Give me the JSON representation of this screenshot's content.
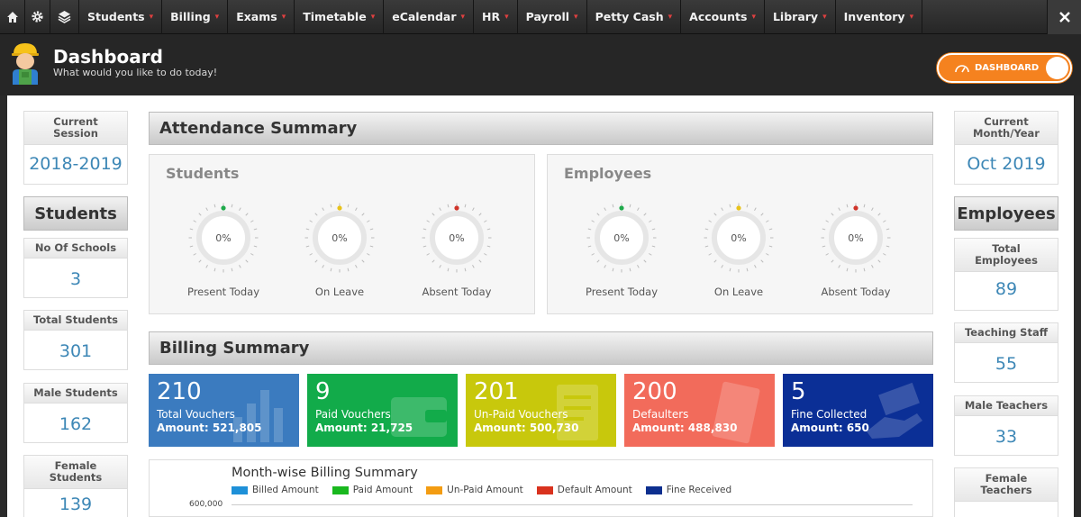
{
  "nav": {
    "items": [
      {
        "label": "Students"
      },
      {
        "label": "Billing"
      },
      {
        "label": "Exams"
      },
      {
        "label": "Timetable"
      },
      {
        "label": "eCalendar"
      },
      {
        "label": "HR"
      },
      {
        "label": "Payroll"
      },
      {
        "label": "Petty Cash"
      },
      {
        "label": "Accounts"
      },
      {
        "label": "Library"
      },
      {
        "label": "Inventory"
      }
    ],
    "icons": [
      "home-icon",
      "gear-icon",
      "layers-icon",
      "close-icon"
    ]
  },
  "header": {
    "title": "Dashboard",
    "subtitle": "What would you like to do today!",
    "toggle_label": "DASHBOARD"
  },
  "left": {
    "session_label": "Current Session",
    "session_value": "2018-2019",
    "section": "Students",
    "stats": [
      {
        "label": "No Of Schools",
        "value": "3"
      },
      {
        "label": "Total Students",
        "value": "301"
      },
      {
        "label": "Male Students",
        "value": "162"
      },
      {
        "label": "Female Students",
        "value": "139"
      }
    ]
  },
  "right": {
    "month_label": "Current Month/Year",
    "month_value": "Oct 2019",
    "section": "Employees",
    "stats": [
      {
        "label": "Total Employees",
        "value": "89"
      },
      {
        "label": "Teaching Staff",
        "value": "55"
      },
      {
        "label": "Male Teachers",
        "value": "33"
      },
      {
        "label": "Female Teachers",
        "value": ""
      }
    ]
  },
  "attendance": {
    "title": "Attendance Summary",
    "students": {
      "title": "Students",
      "gauges": [
        {
          "label": "Present Today",
          "value": "0%",
          "color": "#1faa4b"
        },
        {
          "label": "On Leave",
          "value": "0%",
          "color": "#e8c21a"
        },
        {
          "label": "Absent Today",
          "value": "0%",
          "color": "#d0352a"
        }
      ]
    },
    "employees": {
      "title": "Employees",
      "gauges": [
        {
          "label": "Present Today",
          "value": "0%",
          "color": "#1faa4b"
        },
        {
          "label": "On Leave",
          "value": "0%",
          "color": "#e8c21a"
        },
        {
          "label": "Absent Today",
          "value": "0%",
          "color": "#d0352a"
        }
      ]
    }
  },
  "billing": {
    "title": "Billing Summary",
    "cards": [
      {
        "count": "210",
        "label": "Total Vouchers",
        "amount": "Amount: 521,805",
        "color": "#3b7bbf"
      },
      {
        "count": "9",
        "label": "Paid Vouchers",
        "amount": "Amount: 21,725",
        "color": "#12ab4a"
      },
      {
        "count": "201",
        "label": "Un-Paid Vouchers",
        "amount": "Amount: 500,730",
        "color": "#c8c80c"
      },
      {
        "count": "200",
        "label": "Defaulters",
        "amount": "Amount: 488,830",
        "color": "#f26b5b"
      },
      {
        "count": "5",
        "label": "Fine Collected",
        "amount": "Amount: 650",
        "color": "#0b2f96"
      }
    ]
  },
  "chart_data": {
    "type": "bar",
    "title": "Month-wise Billing Summary",
    "series": [
      {
        "name": "Billed Amount",
        "color": "#1e90d8"
      },
      {
        "name": "Paid Amount",
        "color": "#19b81e"
      },
      {
        "name": "Un-Paid Amount",
        "color": "#f39c12"
      },
      {
        "name": "Default Amount",
        "color": "#d9321e"
      },
      {
        "name": "Fine Received",
        "color": "#0d2f8f"
      }
    ],
    "y_ticks": [
      "600,000"
    ],
    "legend_position": "top"
  }
}
